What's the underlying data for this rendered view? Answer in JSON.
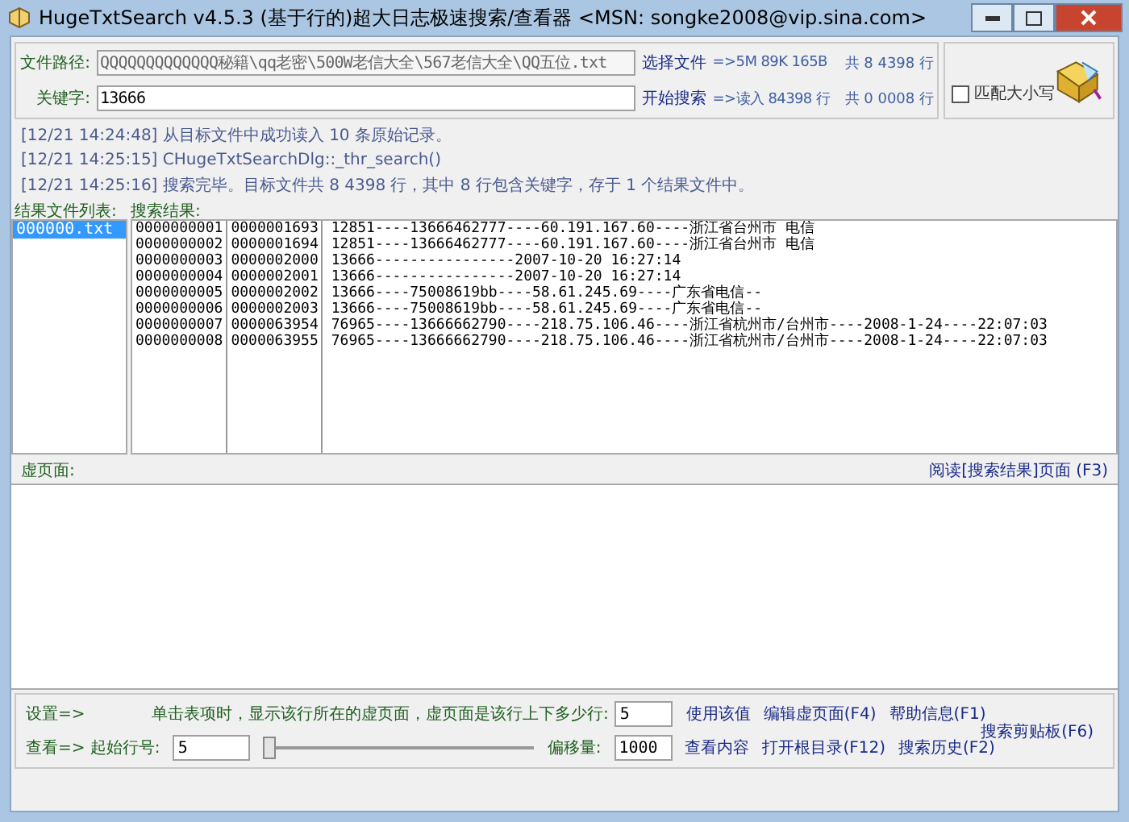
{
  "window": {
    "title": "HugeTxtSearch v4.5.3 (基于行的)超大日志极速搜索/查看器 <MSN: songke2008@vip.sina.com>"
  },
  "search_panel": {
    "path_label": "文件路径:",
    "path_value": "QQQQQQQQQQQQQ秘籍\\qq老密\\500W老信大全\\567老信大全\\QQ五位.txt",
    "keyword_label": "关键字:",
    "keyword_value": "13666",
    "select_file": "选择文件",
    "start_search": "开始搜索",
    "size_info": "=>5M 89K 165B",
    "read_info": "=>读入 84398 行",
    "total_lines": "共 8 4398 行",
    "found_lines": "共 0 0008 行",
    "match_case": {
      "label": "匹配大小写",
      "checked": false
    }
  },
  "log": [
    "[12/21 14:24:48] 从目标文件中成功读入 10 条原始记录。",
    "[12/21 14:25:15] CHugeTxtSearchDlg::_thr_search()",
    "[12/21 14:25:16] 搜索完毕。目标文件共 8 4398 行，其中 8 行包含关键字，存于 1 个结果文件中。"
  ],
  "result_files": {
    "label": "结果文件列表:",
    "items": [
      {
        "name": "000000.txt",
        "selected": true
      }
    ]
  },
  "results": {
    "label": "搜索结果:",
    "rows": [
      {
        "index": "0000000001",
        "line": "0000001693",
        "text": "12851----13666462777----60.191.167.60----浙江省台州市 电信"
      },
      {
        "index": "0000000002",
        "line": "0000001694",
        "text": "12851----13666462777----60.191.167.60----浙江省台州市 电信"
      },
      {
        "index": "0000000003",
        "line": "0000002000",
        "text": "13666----------------2007-10-20 16:27:14"
      },
      {
        "index": "0000000004",
        "line": "0000002001",
        "text": "13666----------------2007-10-20 16:27:14"
      },
      {
        "index": "0000000005",
        "line": "0000002002",
        "text": "13666----75008619bb----58.61.245.69----广东省电信--"
      },
      {
        "index": "0000000006",
        "line": "0000002003",
        "text": "13666----75008619bb----58.61.245.69----广东省电信--"
      },
      {
        "index": "0000000007",
        "line": "0000063954",
        "text": "76965----13666662790----218.75.106.46----浙江省杭州市/台州市----2008-1-24----22:07:03"
      },
      {
        "index": "0000000008",
        "line": "0000063955",
        "text": "76965----13666662790----218.75.106.46----浙江省杭州市/台州市----2008-1-24----22:07:03"
      }
    ]
  },
  "virtual_page": {
    "label": "虚页面:",
    "read_link": "阅读[搜索结果]页面 (F3)"
  },
  "bottom_panel": {
    "settings_label": "设置=>",
    "context_hint": "单击表项时，显示该行所在的虚页面，虚页面是该行上下多少行:",
    "context_value": "5",
    "use_value": "使用该值",
    "edit_page": "编辑虚页面(F4)",
    "help": "帮助信息(F1)",
    "clipboard_search": "搜索剪贴板(F6)",
    "view_label": "查看=> 起始行号:",
    "start_line_value": "5",
    "slider": {
      "level": 0
    },
    "offset_label": "偏移量:",
    "offset_value": "1000",
    "view_content": "查看内容",
    "open_root": "打开根目录(F12)",
    "history": "搜索历史(F2)"
  }
}
